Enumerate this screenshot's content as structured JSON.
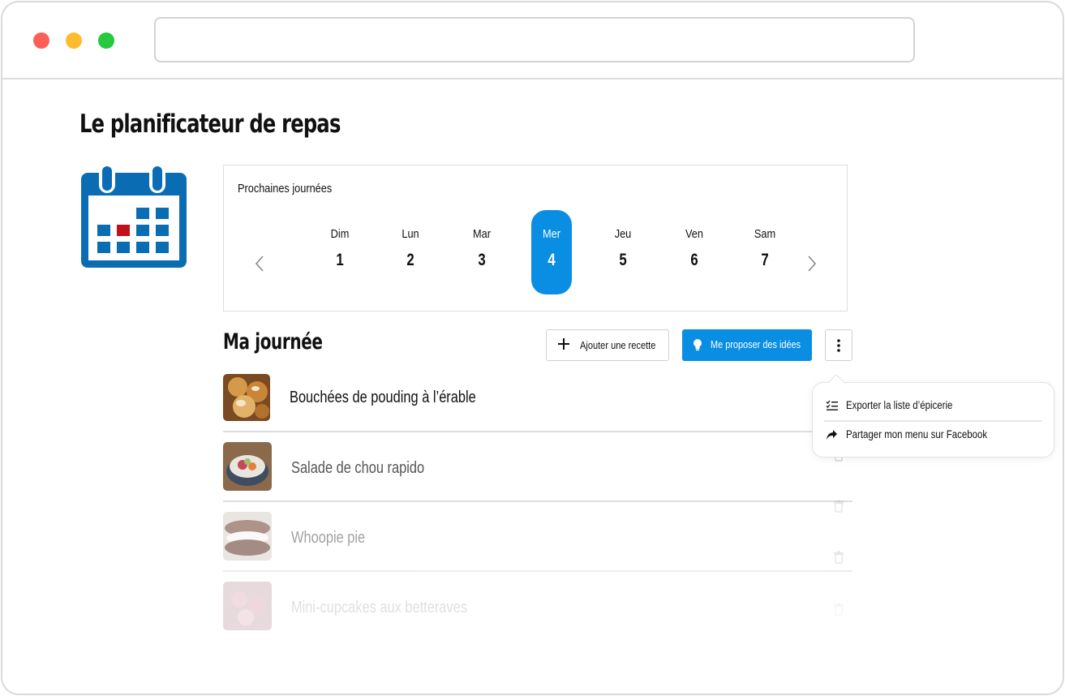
{
  "window": {
    "url": ""
  },
  "page": {
    "title": "Le planificateur de repas"
  },
  "calendar": {
    "caption": "Prochaines journées",
    "days": [
      {
        "name": "Dim",
        "num": "1",
        "active": false
      },
      {
        "name": "Lun",
        "num": "2",
        "active": false
      },
      {
        "name": "Mar",
        "num": "3",
        "active": false
      },
      {
        "name": "Mer",
        "num": "4",
        "active": true
      },
      {
        "name": "Jeu",
        "num": "5",
        "active": false
      },
      {
        "name": "Ven",
        "num": "6",
        "active": false
      },
      {
        "name": "Sam",
        "num": "7",
        "active": false
      }
    ]
  },
  "day_section": {
    "title": "Ma journée",
    "add_label": "Ajouter une recette",
    "ideas_label": "Me proposer des idées"
  },
  "recipes": [
    {
      "name": "Bouchées de pouding à l’érable"
    },
    {
      "name": "Salade de chou rapido"
    },
    {
      "name": "Whoopie pie"
    },
    {
      "name": "Mini-cupcakes aux betteraves"
    }
  ],
  "menu": {
    "export_label": "Exporter la liste d’épicerie",
    "share_label": "Partager mon menu sur Facebook"
  },
  "colors": {
    "accent": "#0a8ee3",
    "brand_blue": "#0a6db3",
    "marker_red": "#c0121c"
  }
}
